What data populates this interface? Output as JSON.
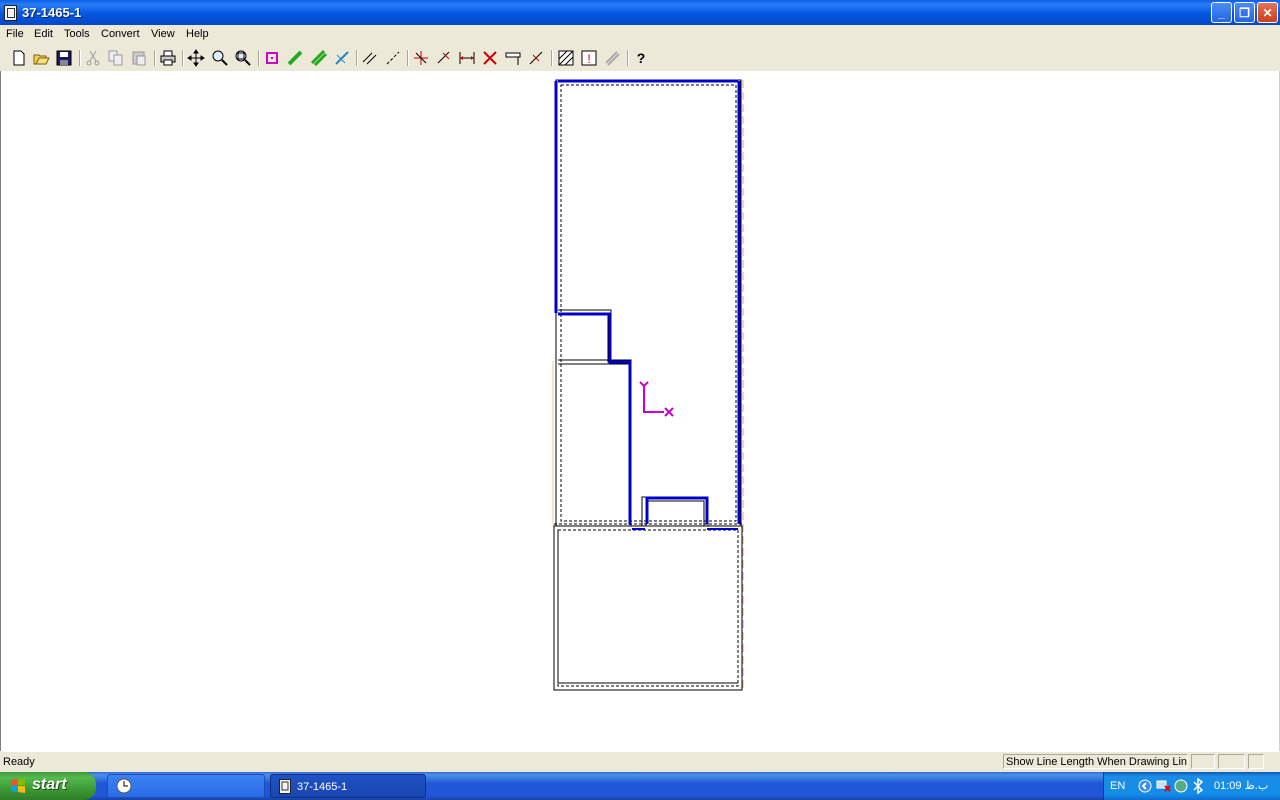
{
  "window": {
    "title": "37-1465-1"
  },
  "menu": [
    "File",
    "Edit",
    "Tools",
    "Convert",
    "View",
    "Help"
  ],
  "toolbar": {
    "tools": [
      "new-icon",
      "open-icon",
      "save-icon",
      "cut-icon",
      "copy-icon",
      "paste-icon",
      "print-icon",
      "pan-icon",
      "zoom-icon",
      "zoom-window-icon",
      "point-icon",
      "line-icon",
      "double-line-icon",
      "trim-icon",
      "parallel-line-icon",
      "dashed-line-icon",
      "mirror-icon",
      "move-icon",
      "dimension-icon",
      "delete-icon",
      "scale-icon",
      "break-icon",
      "hatch-icon",
      "text-icon",
      "layers-icon",
      "help-icon"
    ]
  },
  "canvas": {
    "axis_labels": {
      "x": "X",
      "y": "Y"
    }
  },
  "status": {
    "ready": "Ready",
    "hint": "Show Line Length When Drawing Line"
  },
  "taskbar": {
    "start": "start",
    "task_title": "37-1465-1",
    "lang": "EN",
    "clock": "01:09 ب.ظ"
  },
  "colors": {
    "accent": "#0000cc",
    "axis": "#cc00cc",
    "guide": "#e0a090"
  }
}
